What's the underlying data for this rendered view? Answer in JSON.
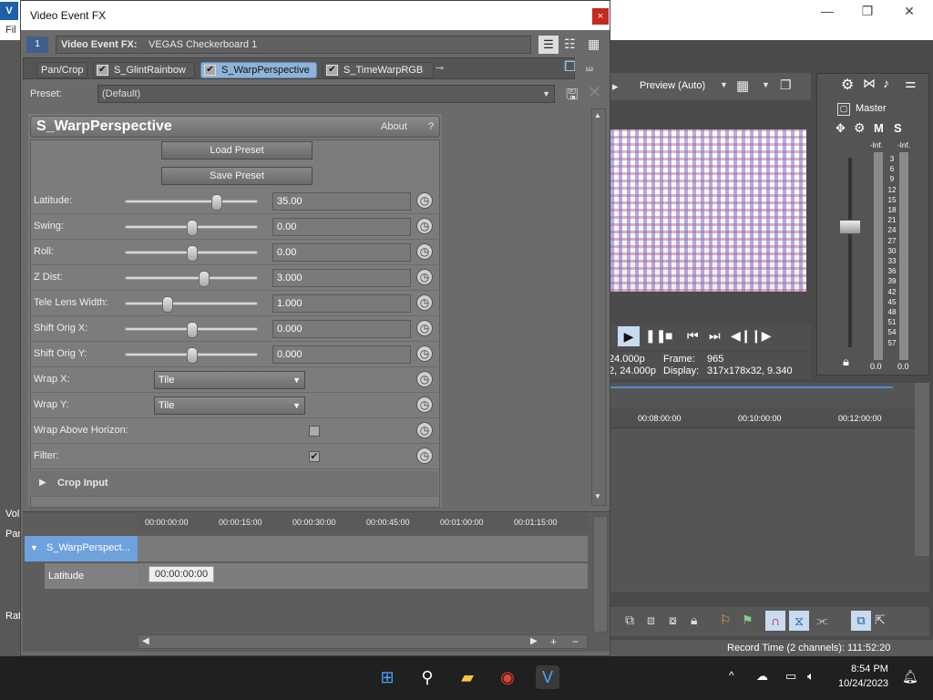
{
  "app": {
    "menu_first": "Fil",
    "preview_mode": "Preview (Auto)",
    "frame_rate_1": "24.000p",
    "frame_label": "Frame:",
    "frame_value": "965",
    "frame_rate_2": "2, 24.000p",
    "display_label": "Display:",
    "display_value": "317x178x32, 9.340",
    "master_label": "Master",
    "mixer_m": "M",
    "mixer_s": "S",
    "meter_inf_left": "-Inf.",
    "meter_inf_right": "-Inf.",
    "meter_scale": [
      "3",
      "6",
      "9",
      "12",
      "15",
      "18",
      "21",
      "24",
      "27",
      "30",
      "33",
      "36",
      "39",
      "42",
      "45",
      "48",
      "51",
      "54",
      "57"
    ],
    "meter_val_left": "0.0",
    "meter_val_right": "0.0",
    "timeline_ticks": [
      "00:08:00:00",
      "00:10:00:00",
      "00:12:00:00"
    ],
    "left_labels": [
      "Vol",
      "Par",
      "Rat"
    ],
    "status_text": "Record Time (2 channels): 111:52:20"
  },
  "fx": {
    "window_title": "Video Event FX",
    "close_glyph": "×",
    "track_badge": "1",
    "header_label": "Video Event FX:",
    "header_value": "VEGAS Checkerboard 1",
    "chain": [
      {
        "label": "Pan/Crop",
        "checked": false
      },
      {
        "label": "S_GlintRainbow",
        "checked": true
      },
      {
        "label": "S_WarpPerspective",
        "checked": true,
        "selected": true
      },
      {
        "label": "S_TimeWarpRGB",
        "checked": true
      }
    ],
    "preset_label": "Preset:",
    "preset_value": "(Default)",
    "plugin_name": "S_WarpPerspective",
    "about_label": "About",
    "help_label": "?",
    "load_preset": "Load Preset",
    "save_preset": "Save Preset",
    "params": [
      {
        "name": "Latitude:",
        "value": "35.00",
        "pos": 0.7
      },
      {
        "name": "Swing:",
        "value": "0.00",
        "pos": 0.5
      },
      {
        "name": "Roll:",
        "value": "0.00",
        "pos": 0.5
      },
      {
        "name": "Z Dist:",
        "value": "3.000",
        "pos": 0.6
      },
      {
        "name": "Tele Lens Width:",
        "value": "1.000",
        "pos": 0.3
      },
      {
        "name": "Shift Orig X:",
        "value": "0.000",
        "pos": 0.5
      },
      {
        "name": "Shift Orig Y:",
        "value": "0.000",
        "pos": 0.5
      }
    ],
    "wrap_x_label": "Wrap X:",
    "wrap_x_value": "Tile",
    "wrap_y_label": "Wrap Y:",
    "wrap_y_value": "Tile",
    "wrap_above_label": "Wrap Above Horizon:",
    "filter_label": "Filter:",
    "filter_checked": true,
    "crop_input_label": "Crop Input",
    "kf_ticks": [
      "00:00:00:00",
      "00:00:15:00",
      "00:00:30:00",
      "00:00:45:00",
      "00:01:00:00",
      "00:01:15:00"
    ],
    "kf_track_name": "S_WarpPerspect...",
    "kf_param_name": "Latitude",
    "kf_tooltip": "00:00:00:00"
  },
  "taskbar": {
    "time": "8:54 PM",
    "date": "10/24/2023"
  }
}
